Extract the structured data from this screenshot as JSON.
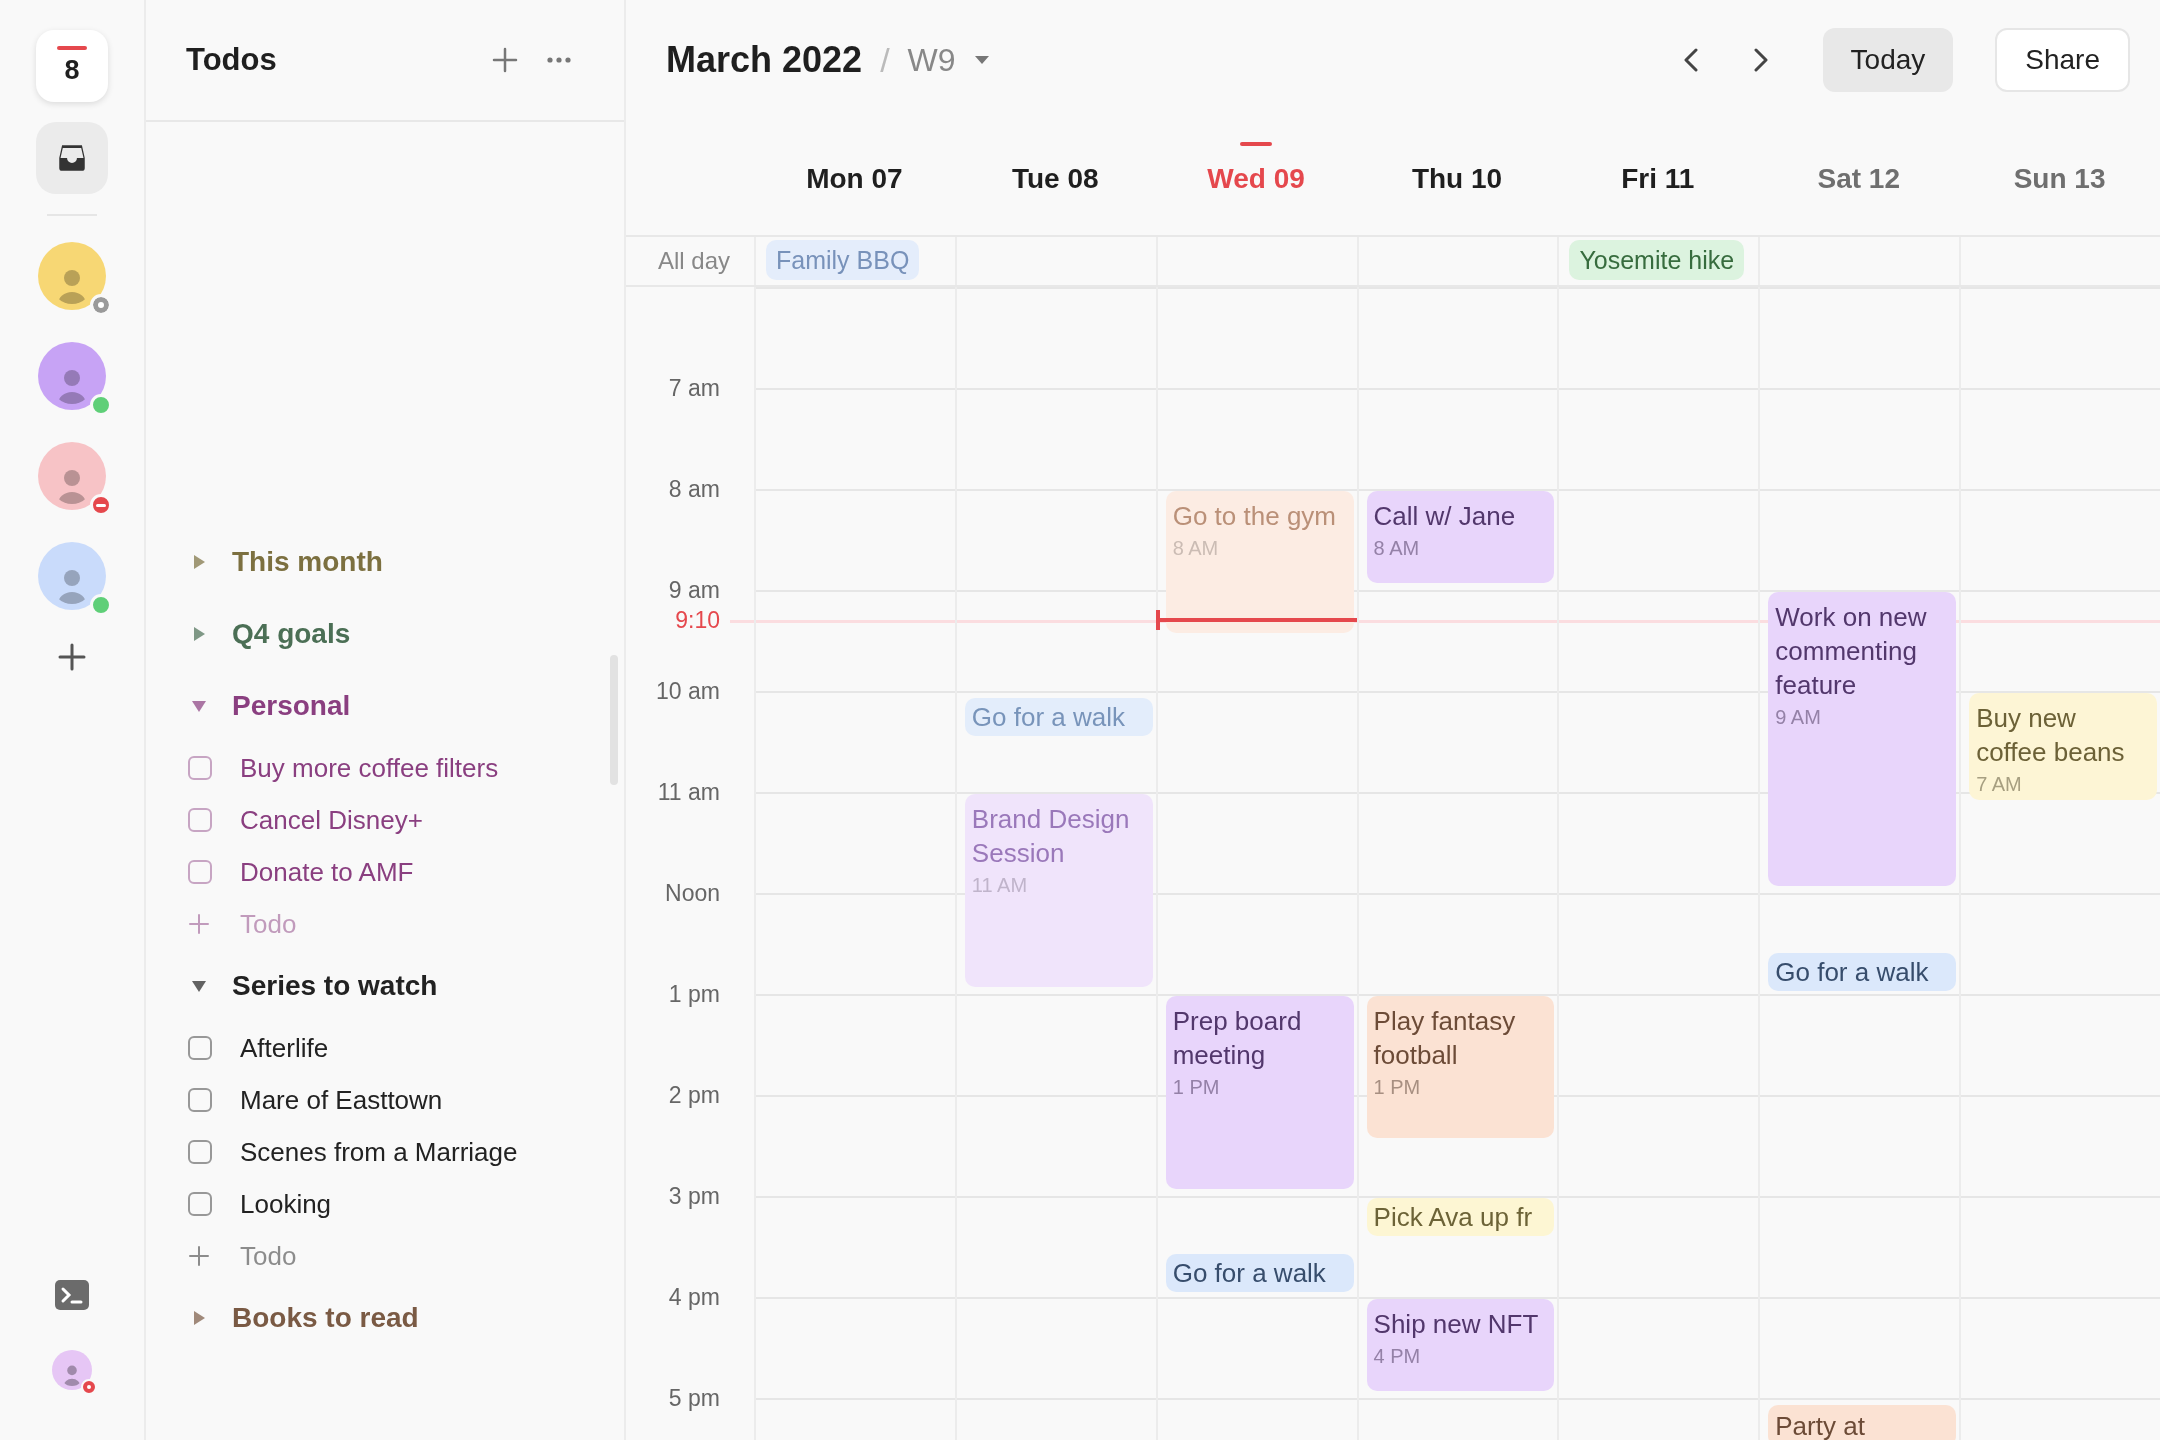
{
  "rail": {
    "calendar_day": "8",
    "inbox": {
      "selected": true
    },
    "people": [
      {
        "color": "#f7d774",
        "kind": "away"
      },
      {
        "color": "#c7a3f5",
        "kind": "online"
      },
      {
        "color": "#f7c3c6",
        "kind": "busy"
      },
      {
        "color": "#c9dbfb",
        "kind": "online"
      }
    ],
    "me": {
      "color": "#e6c6f5",
      "kind": "live"
    }
  },
  "todos": {
    "title": "Todos",
    "sections": [
      {
        "title": "This month",
        "color": "#7c7040",
        "expanded": false
      },
      {
        "title": "Q4 goals",
        "color": "#4b6f55",
        "expanded": false
      },
      {
        "title": "Personal",
        "color": "#8a3f80",
        "expanded": true,
        "items": [
          {
            "text": "Buy more coffee filters",
            "checked": false
          },
          {
            "text": "Cancel Disney+",
            "checked": false
          },
          {
            "text": "Donate to AMF",
            "checked": false
          }
        ],
        "add_label": "Todo"
      },
      {
        "title": "Series to watch",
        "color": "#222222",
        "expanded": true,
        "items": [
          {
            "text": "Afterlife",
            "checked": false
          },
          {
            "text": "Mare of Easttown",
            "checked": false
          },
          {
            "text": "Scenes from a Marriage",
            "checked": false
          },
          {
            "text": "Looking",
            "checked": false
          }
        ],
        "add_label": "Todo"
      },
      {
        "title": "Books to read",
        "color": "#7a5a44",
        "expanded": false
      }
    ]
  },
  "calendar": {
    "month": "March 2022",
    "separator": "/",
    "week": "W9",
    "buttons": [
      "Today",
      "Share"
    ],
    "all_day_label": "All day",
    "now_label": "9:10",
    "hours": [
      "7 am",
      "8 am",
      "9 am",
      "10 am",
      "11 am",
      "Noon",
      "1 pm",
      "2 pm",
      "3 pm",
      "4 pm",
      "5 pm"
    ],
    "days": [
      {
        "label": "Mon 07",
        "today": false,
        "weekend": false,
        "all_day": [
          {
            "title": "Family BBQ",
            "color": "#e4edfb",
            "past": true
          }
        ]
      },
      {
        "label": "Tue 08",
        "today": false,
        "weekend": false,
        "events": [
          {
            "title": "Go for a walk",
            "color": "#e3edfb",
            "past": true
          },
          {
            "title": "Brand Design Session",
            "time": "11 AM",
            "color": "#f0e4fb",
            "past": true
          }
        ]
      },
      {
        "label": "Wed 09",
        "today": true,
        "weekend": false,
        "events": [
          {
            "title": "Go to the gym",
            "time": "8 AM",
            "color": "#fcece3",
            "past": true
          },
          {
            "title": "Prep board meeting",
            "time": "1 PM",
            "color": "#e8d5fb",
            "past": false
          },
          {
            "title": "Go for a walk",
            "color": "#dbe8fb",
            "past": false
          }
        ]
      },
      {
        "label": "Thu 10",
        "today": false,
        "weekend": false,
        "events": [
          {
            "title": "Call w/ Jane",
            "time": "8 AM",
            "color": "#e8d5fb",
            "past": false
          },
          {
            "title": "Play fantasy football",
            "time": "1 PM",
            "color": "#fbe2d3",
            "past": false
          },
          {
            "title": "Pick Ava up fr",
            "color": "#fdf6d3",
            "past": false
          },
          {
            "title": "Ship new NFT",
            "time": "4 PM",
            "color": "#e8d5fb",
            "past": false
          }
        ]
      },
      {
        "label": "Fri 11",
        "today": false,
        "weekend": false,
        "all_day": [
          {
            "title": "Yosemite hike",
            "color": "#dcf3df",
            "past": false
          }
        ]
      },
      {
        "label": "Sat 12",
        "today": false,
        "weekend": true,
        "events": [
          {
            "title": "Work on new commenting feature",
            "time": "9 AM",
            "color": "#e8d5fb",
            "past": false
          },
          {
            "title": "Go for a walk",
            "color": "#dbe8fb",
            "past": false
          },
          {
            "title": "Party at",
            "color": "#fbe2d3",
            "past": false
          }
        ]
      },
      {
        "label": "Sun 13",
        "today": false,
        "weekend": true,
        "events": [
          {
            "title": "Buy new coffee beans",
            "time": "7 AM",
            "color": "#fdf5d5",
            "past": false
          }
        ]
      }
    ]
  }
}
